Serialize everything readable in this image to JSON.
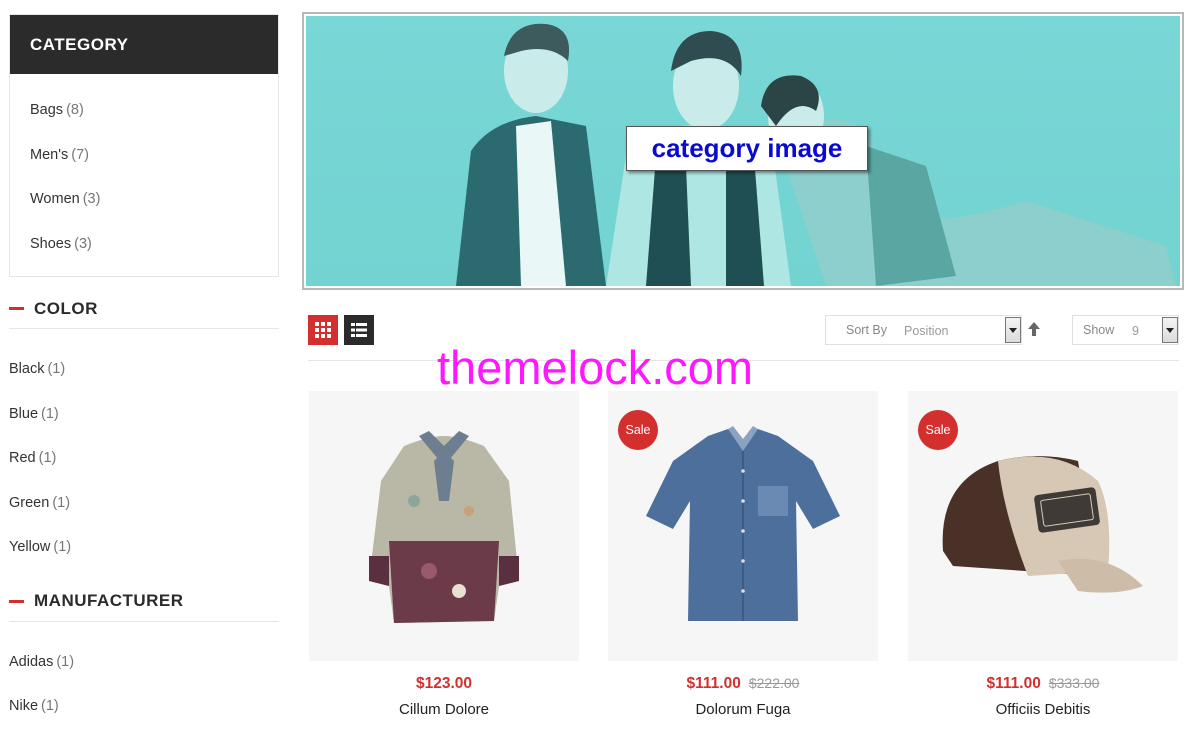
{
  "sidebar": {
    "category": {
      "title": "CATEGORY",
      "items": [
        {
          "label": "Bags",
          "count": "(8)"
        },
        {
          "label": "Men's",
          "count": "(7)"
        },
        {
          "label": "Women",
          "count": "(3)"
        },
        {
          "label": "Shoes",
          "count": "(3)"
        }
      ]
    },
    "color": {
      "title": "COLOR",
      "items": [
        {
          "label": "Black",
          "count": "(1)"
        },
        {
          "label": "Blue",
          "count": "(1)"
        },
        {
          "label": "Red",
          "count": "(1)"
        },
        {
          "label": "Green",
          "count": "(1)"
        },
        {
          "label": "Yellow",
          "count": "(1)"
        }
      ]
    },
    "manufacturer": {
      "title": "MANUFACTURER",
      "items": [
        {
          "label": "Adidas",
          "count": "(1)"
        },
        {
          "label": "Nike",
          "count": "(1)"
        }
      ]
    }
  },
  "banner": {
    "label": "category image"
  },
  "toolbar": {
    "grid_icon": "grid-icon",
    "list_icon": "list-icon",
    "sort_label": "Sort By",
    "sort_value": "Position",
    "show_label": "Show",
    "show_value": "9"
  },
  "watermark": "themelock.com",
  "products": [
    {
      "name": "Cillum Dolore",
      "price": "$123.00",
      "old_price": "",
      "badge": ""
    },
    {
      "name": "Dolorum Fuga",
      "price": "$111.00",
      "old_price": "$222.00",
      "badge": "Sale"
    },
    {
      "name": "Officiis Debitis",
      "price": "$111.00",
      "old_price": "$333.00",
      "badge": "Sale"
    }
  ],
  "colors": {
    "accent": "#d32f2f",
    "dark": "#2b2b2b",
    "banner": "#79d7d6",
    "watermark": "#ff18ff"
  }
}
